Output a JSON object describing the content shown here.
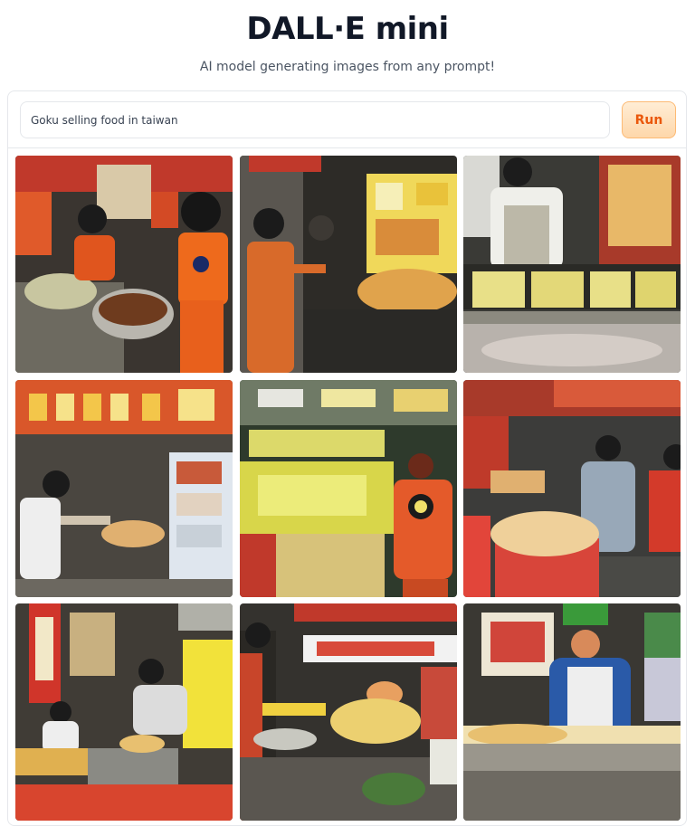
{
  "header": {
    "title": "DALL·E mini",
    "subtitle": "AI model generating images from any prompt!"
  },
  "prompt": {
    "value": "Goku selling food in taiwan"
  },
  "run_button": {
    "label": "Run"
  },
  "colors": {
    "accent": "#ea580c",
    "accent_bg": "#fed7aa",
    "border": "#e5e7eb"
  },
  "gallery": {
    "image_count": 9
  }
}
